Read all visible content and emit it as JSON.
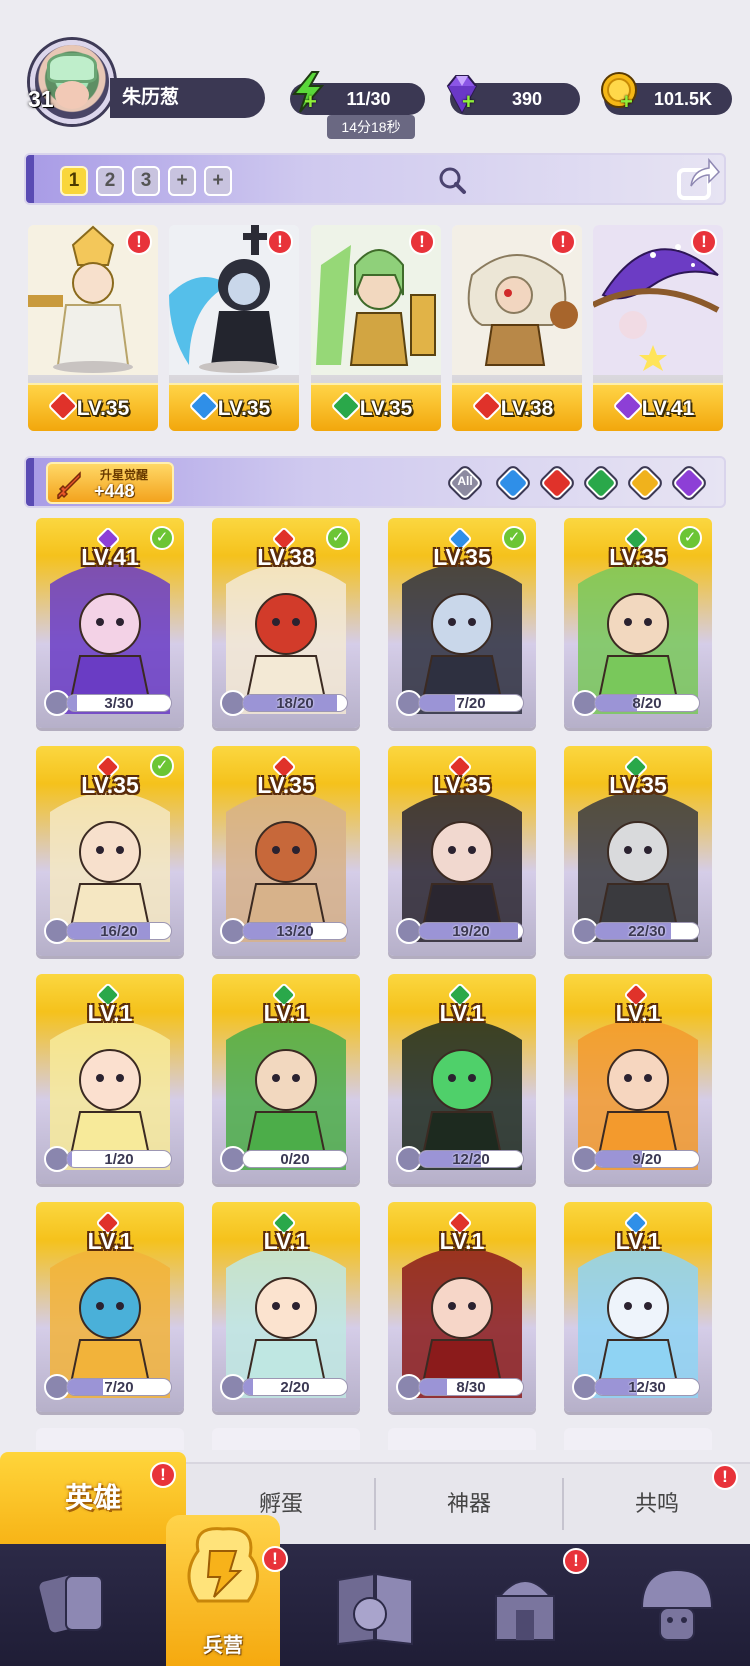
{
  "player": {
    "level": "31",
    "name": "朱历葱"
  },
  "resources": {
    "energy": "11/30",
    "energy_timer": "14分18秒",
    "gems": "390",
    "coins": "101.5K"
  },
  "lineup": {
    "slots": [
      "1",
      "2",
      "3",
      "+",
      "+"
    ],
    "active_slot": "1"
  },
  "team": [
    {
      "level": "LV.35",
      "element": "fire",
      "alert": "!"
    },
    {
      "level": "LV.35",
      "element": "water",
      "alert": "!"
    },
    {
      "level": "LV.35",
      "element": "wind",
      "alert": "!"
    },
    {
      "level": "LV.38",
      "element": "fire",
      "alert": "!"
    },
    {
      "level": "LV.41",
      "element": "dark",
      "alert": "!"
    }
  ],
  "awaken": {
    "label": "升星觉醒",
    "count": "+448"
  },
  "filters": {
    "all_label": "All",
    "elements": [
      "water",
      "fire",
      "wind",
      "light",
      "dark"
    ]
  },
  "colors": {
    "fire": "#e0322a",
    "water": "#2f8fe8",
    "wind": "#2aa84a",
    "light": "#f0b21c",
    "dark": "#8d3fd6",
    "accent": "#f7c21e"
  },
  "heroes": [
    {
      "level": "LV.41",
      "element": "dark",
      "shards": "3/30",
      "progress": 0.1,
      "ready": true
    },
    {
      "level": "LV.38",
      "element": "fire",
      "shards": "18/20",
      "progress": 0.9,
      "ready": true
    },
    {
      "level": "LV.35",
      "element": "water",
      "shards": "7/20",
      "progress": 0.35,
      "ready": true
    },
    {
      "level": "LV.35",
      "element": "wind",
      "shards": "8/20",
      "progress": 0.4,
      "ready": true
    },
    {
      "level": "LV.35",
      "element": "fire",
      "shards": "16/20",
      "progress": 0.8,
      "ready": true
    },
    {
      "level": "LV.35",
      "element": "fire",
      "shards": "13/20",
      "progress": 0.65,
      "ready": false
    },
    {
      "level": "LV.35",
      "element": "fire",
      "shards": "19/20",
      "progress": 0.95,
      "ready": false
    },
    {
      "level": "LV.35",
      "element": "wind",
      "shards": "22/30",
      "progress": 0.73,
      "ready": false
    },
    {
      "level": "LV.1",
      "element": "wind",
      "shards": "1/20",
      "progress": 0.05,
      "ready": false
    },
    {
      "level": "LV.1",
      "element": "wind",
      "shards": "0/20",
      "progress": 0,
      "ready": false
    },
    {
      "level": "LV.1",
      "element": "wind",
      "shards": "12/20",
      "progress": 0.6,
      "ready": false
    },
    {
      "level": "LV.1",
      "element": "fire",
      "shards": "9/20",
      "progress": 0.45,
      "ready": false
    },
    {
      "level": "LV.1",
      "element": "fire",
      "shards": "7/20",
      "progress": 0.35,
      "ready": false
    },
    {
      "level": "LV.1",
      "element": "wind",
      "shards": "2/20",
      "progress": 0.1,
      "ready": false
    },
    {
      "level": "LV.1",
      "element": "fire",
      "shards": "8/30",
      "progress": 0.27,
      "ready": false
    },
    {
      "level": "LV.1",
      "element": "water",
      "shards": "12/30",
      "progress": 0.4,
      "ready": false
    }
  ],
  "tabs": [
    "英雄",
    "孵蛋",
    "神器",
    "共鸣"
  ],
  "nav": {
    "barracks_label": "兵营"
  },
  "alert_mark": "!"
}
